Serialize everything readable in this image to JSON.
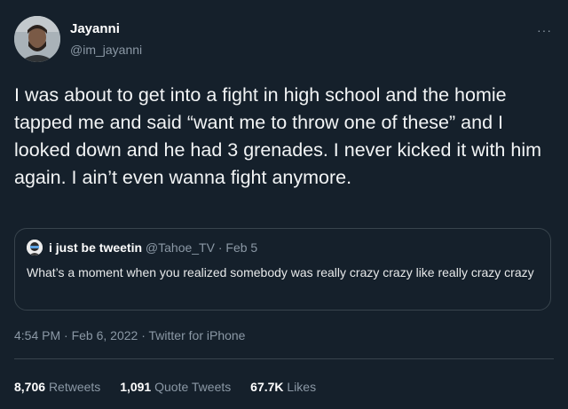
{
  "tweet": {
    "author_name": "Jayanni",
    "author_handle": "@im_jayanni",
    "more_icon": "···",
    "text": "I was about to get into a fight in high school and the homie tapped me and said “want me to throw one of these” and I looked down and he had 3 grenades. I never kicked it with him again. I ain’t even wanna fight anymore.",
    "time": "4:54 PM",
    "date": "Feb 6, 2022",
    "source": "Twitter for iPhone",
    "separator": " · "
  },
  "quote": {
    "author_name": "i just be tweetin",
    "author_handle": "@Tahoe_TV",
    "date": "Feb 5",
    "text": "What’s a moment when you realized somebody was really crazy crazy like really crazy crazy"
  },
  "stats": {
    "retweets_count": "8,706",
    "retweets_label": "Retweets",
    "quotes_count": "1,091",
    "quotes_label": "Quote Tweets",
    "likes_count": "67.7K",
    "likes_label": "Likes"
  },
  "colors": {
    "background": "#15202b",
    "secondary_text": "#8b98a5",
    "border": "#38444d"
  }
}
